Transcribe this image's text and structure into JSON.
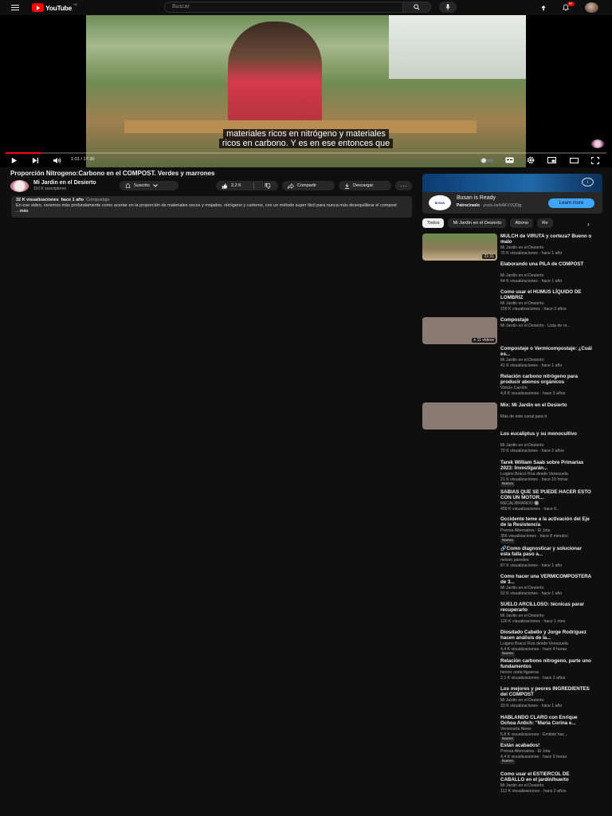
{
  "masthead": {
    "logo_text": "YouTube",
    "country": "VE",
    "search_placeholder": "Buscar",
    "notif_count": "9+"
  },
  "player": {
    "subtitle_line1": "materiales ricos en nitrógeno y materiales",
    "subtitle_line2": "ricos en carbono. Y es en ese entonces que",
    "time": "1:01 / 17:30",
    "progress": 0.06
  },
  "video": {
    "title": "Proporción Nitrogeno:Carbono en el COMPOST. Verdes y marrones",
    "channel": "Mi Jardin en el Desierto",
    "subscribers": "110 K suscriptores",
    "subscribed_label": "Suscrito",
    "likes": "2,2 K",
    "share_label": "Compartir",
    "download_label": "Descargar"
  },
  "description": {
    "views": "32 K visualizaciones",
    "date": "hace 1 año",
    "tag": "Compostaje",
    "text": "En ese video, veremos más profundamente como acertar en la proporción de materiales secos y mojados, nitrógeno y carbono, con un método super fácil para nunca más desequilibrar el compost ...",
    "more": "más"
  },
  "ad": {
    "name": "Busan is Ready",
    "sponsored": "Patrocinado",
    "url": "youtu.be/bAKVVQDjg",
    "cta": "Learn more"
  },
  "chips": [
    "Todos",
    "Mi Jardin en el Desierto",
    "Abono",
    "Re"
  ],
  "recs": [
    {
      "title": "MULCH de VIRUTA y corteza? Bueno o malo",
      "channel": "Mi Jardin en el Desierto",
      "views": "75 K visualizaciones",
      "age": "hace 1 año",
      "duration": "21:31"
    },
    {
      "title": "Elaborando una PILA de COMPOST",
      "channel": "Mi Jardin en el Desierto",
      "views": "64 K visualizaciones",
      "age": "hace 1 año"
    },
    {
      "title": "Como usar el HUMUS LÍQUIDO DE LOMBRIZ",
      "channel": "Mi Jardin en el Desierto",
      "views": "159 K visualizaciones",
      "age": "hace 3 años"
    },
    {
      "title": "Compostaje",
      "channel": "Mi Jardin en el Desierto · Lista de re...",
      "videos": "11 vídeos"
    },
    {
      "title": "Compostaje o Vermicompostaje: ¿Cuál es...",
      "channel": "Mi Jardin en el Desierto",
      "views": "41 K visualizaciones",
      "age": "hace 1 año"
    },
    {
      "title": "Relación carbono nitrógeno para producir abonos orgánicos",
      "channel": "Vinicio Carrión",
      "views": "4,8 K visualizaciones",
      "age": "hace 3 años"
    },
    {
      "title": "Mix: Mi Jardin en el Desierto",
      "channel": "Más de este canal para ti"
    },
    {
      "title": "Los eucaliptus y su monocultivo",
      "channel": "Mi Jardin en el Desierto",
      "views": "70 K visualizaciones",
      "age": "hace 2 años"
    },
    {
      "title": "Tarek William Saab sobre Primarias 2023: Investigarán...",
      "channel": "Luigino Bracci Roa desde Venezuela",
      "views": "21 K visualizaciones",
      "age": "hace 15 horas",
      "badge": "Nuevo"
    },
    {
      "title": "SABIAS QUE SE PUEDE HACER ESTO CON UN MOTOR...",
      "channel": "RECALIBRANDO 🔘",
      "views": "459 K visualizaciones",
      "age": "hace 6..."
    },
    {
      "title": "Occidente teme a la activación del Eje de la Resistencia",
      "channel": "Prensa Alternativa - El Jota",
      "views": "356 visualizaciones",
      "age": "hace 8 minutos",
      "badge": "Nuevo"
    },
    {
      "title": "🔗Como diagnosticar y solucionar esta falla paso a...",
      "channel": "nelson paredes",
      "views": "87 K visualizaciones",
      "age": "hace 1 año"
    },
    {
      "title": "Como hacer una VERMICOMPOSTERA de 3...",
      "channel": "Mi Jardin en el Desierto",
      "views": "92 K visualizaciones",
      "age": "hace 1 año"
    },
    {
      "title": "SUELO ARCILLOSO: técnicas parar recuperarlo",
      "channel": "Mi Jardin en el Desierto",
      "views": "120 K visualizaciones",
      "age": "hace 1 mes"
    },
    {
      "title": "Diosdado Cabello y Jorge Rodríguez hacen análisis de la...",
      "channel": "Luigino Bracci Roa desde Venezuela",
      "views": "4,4 K visualizaciones",
      "age": "hace 4 horas",
      "badge": "Nuevo"
    },
    {
      "title": "Relación carbono nitrogeno, parte uno fundamentos",
      "channel": "hector ureta figueroa",
      "views": "2,1 K visualizaciones",
      "age": "hace 2 años"
    },
    {
      "title": "Los mejores y peores INGREDIENTES del COMPOST",
      "channel": "Mi Jardin en el Desierto",
      "views": "33 K visualizaciones",
      "age": "hace 1 año"
    },
    {
      "title": "HABLANDO CLARO con Enrique Ochoa Antich: \"Maria Corina e...",
      "channel": "Venezuela News",
      "views": "5,8 K visualizaciones",
      "age": "Emitido hac...",
      "badge": "Nuevo"
    },
    {
      "title": "Están acabados!",
      "channel": "Prensa Alternativa - El Jota",
      "views": "4,4 K visualizaciones",
      "age": "hace 6 horas",
      "badge": "Nuevo"
    },
    {
      "title": "Como usar el ESTIERCOL DE CABALLO en el jardín/huerto",
      "channel": "Mi Jardin en el Desierto",
      "views": "112 K visualizaciones",
      "age": "hace 2 años"
    }
  ]
}
